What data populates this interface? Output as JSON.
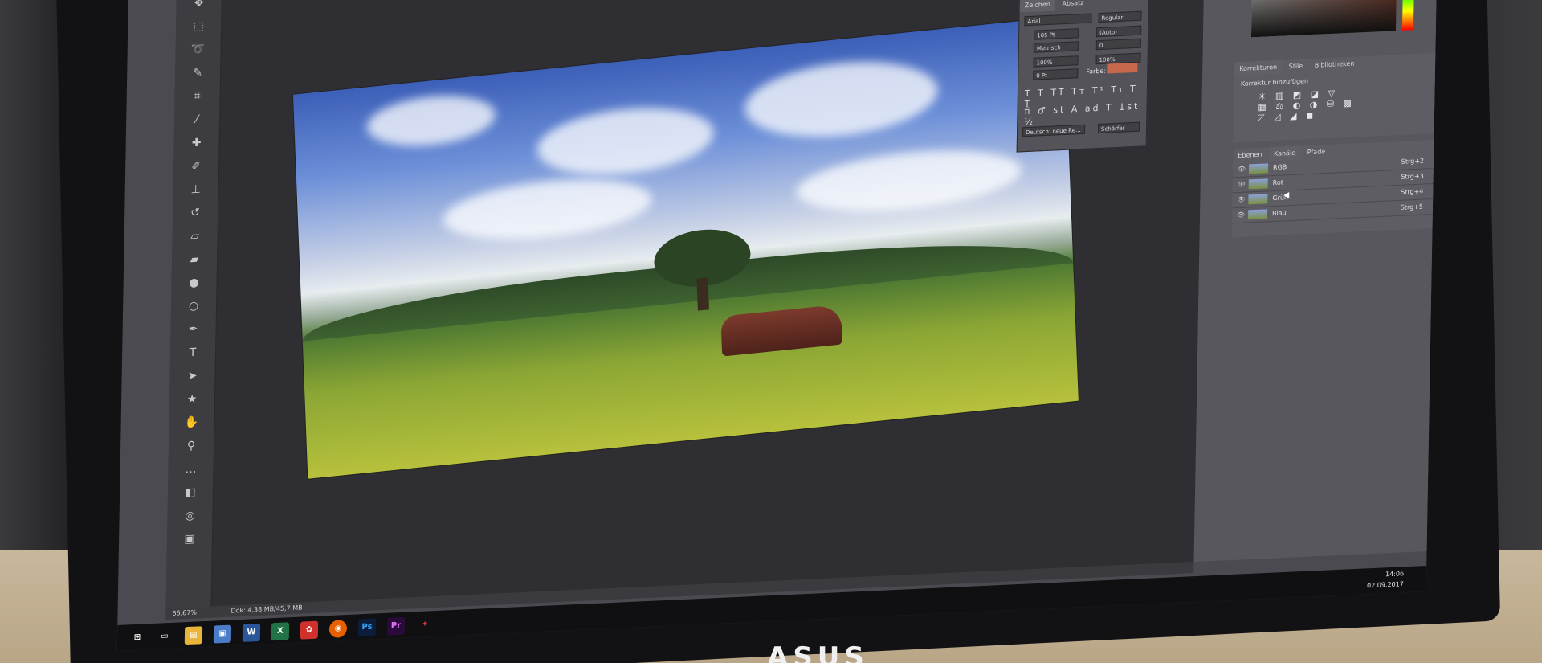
{
  "app": {
    "name": "Adobe Photoshop"
  },
  "character_panel": {
    "tabs": [
      "Zeichen",
      "Absatz"
    ],
    "font_family": "Arial",
    "font_style": "Regular",
    "size": "105 Pt",
    "leading": "(Auto)",
    "kerning": "Metrisch",
    "tracking": "0",
    "vscale": "100%",
    "hscale": "100%",
    "baseline": "0 Pt",
    "color_label": "Farbe:",
    "language": "Deutsch: neue Re...",
    "antialias": "Schärfer",
    "swatch_color": "#c7684c"
  },
  "adjustments_panel": {
    "tabs": [
      "Korrekturen",
      "Stile",
      "Bibliotheken"
    ],
    "heading": "Korrektur hinzufügen"
  },
  "channels_panel": {
    "tabs": [
      "Ebenen",
      "Kanäle",
      "Pfade"
    ],
    "channels": [
      {
        "name": "RGB",
        "shortcut": "Strg+2"
      },
      {
        "name": "Rot",
        "shortcut": "Strg+3"
      },
      {
        "name": "Grün",
        "shortcut": "Strg+4"
      },
      {
        "name": "Blau",
        "shortcut": "Strg+5"
      }
    ]
  },
  "statusbar": {
    "zoom": "66,67%",
    "doc": "Dok: 4,38 MB/45,7 MB"
  },
  "taskbar": {
    "time": "14:06",
    "date": "02.09.2017",
    "apps": [
      "W",
      "X",
      "Ps",
      "Pr"
    ]
  },
  "brand": "ASUS"
}
